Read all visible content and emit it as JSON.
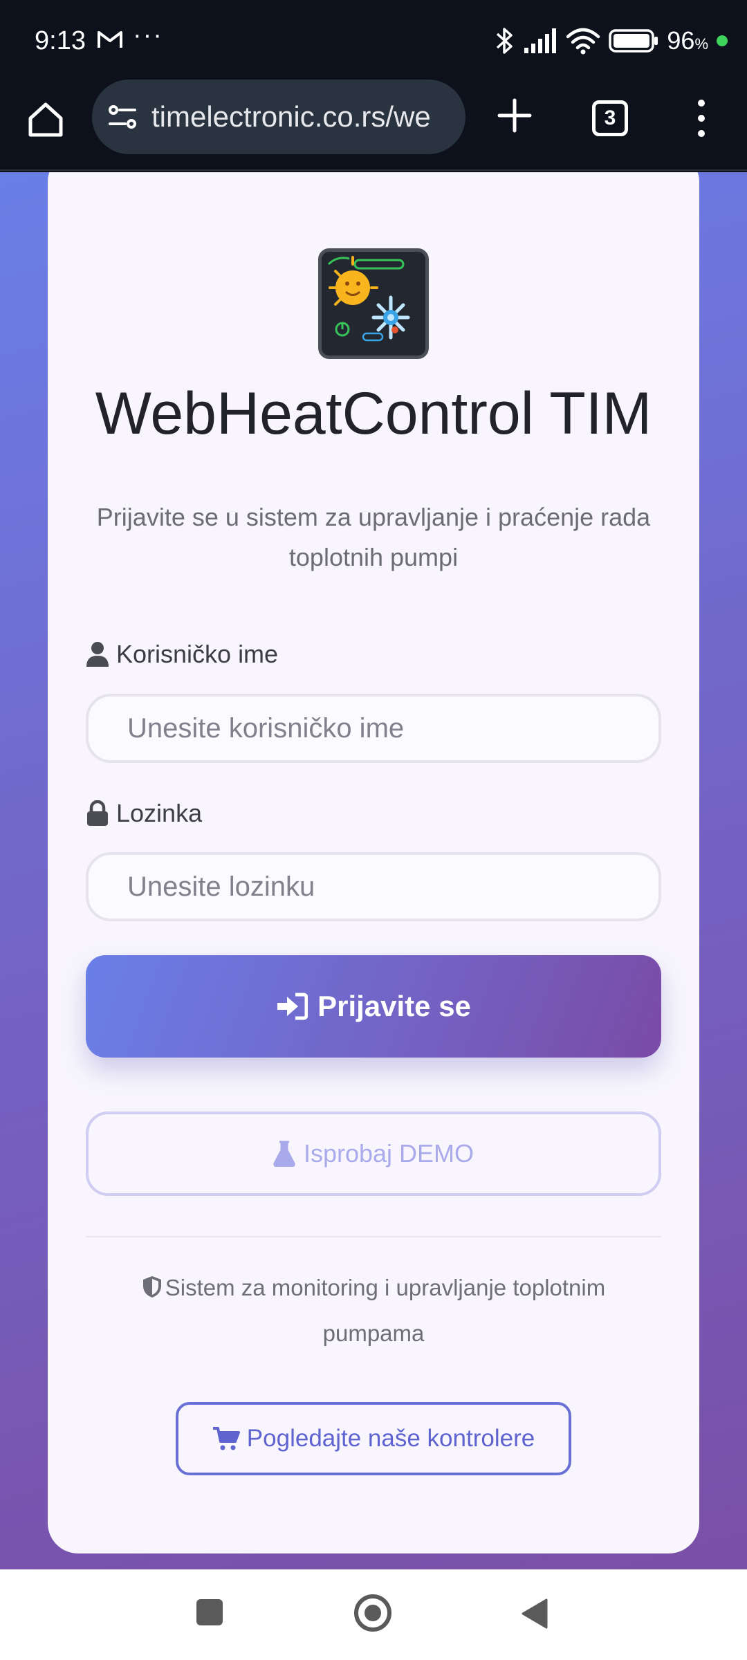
{
  "status_bar": {
    "time": "9:13",
    "dots": "···",
    "battery_number": "96",
    "battery_percent_sign": "%",
    "icons": [
      "gmail-icon",
      "bluetooth-icon",
      "signal-icon",
      "wifi-icon",
      "battery-icon"
    ]
  },
  "browser": {
    "url": "timelectronic.co.rs/we",
    "tab_count": "3",
    "icons": [
      "home-icon",
      "site-settings-icon",
      "new-tab-icon",
      "tabs-icon",
      "menu-icon"
    ]
  },
  "login": {
    "app_title": "WebHeatControl TIM",
    "subtitle": "Prijavite se u sistem za upravljanje i praćenje rada toplotnih pumpi",
    "username_label": "Korisničko ime",
    "username_placeholder": "Unesite korisničko ime",
    "username_value": "",
    "password_label": "Lozinka",
    "password_placeholder": "Unesite lozinku",
    "password_value": "",
    "login_button": "Prijavite se",
    "demo_button": "Isprobaj DEMO",
    "footer_text": "Sistem za monitoring i upravljanje toplotnim pumpama",
    "shop_button": "Pogledajte naše kontrolere"
  },
  "colors": {
    "accent": "#6a7fe8",
    "accent_dark": "#7a4ba6",
    "card_bg": "#f8f6fc",
    "demo_text": "#a9aaeb",
    "shop_border": "#6a6fd6"
  }
}
